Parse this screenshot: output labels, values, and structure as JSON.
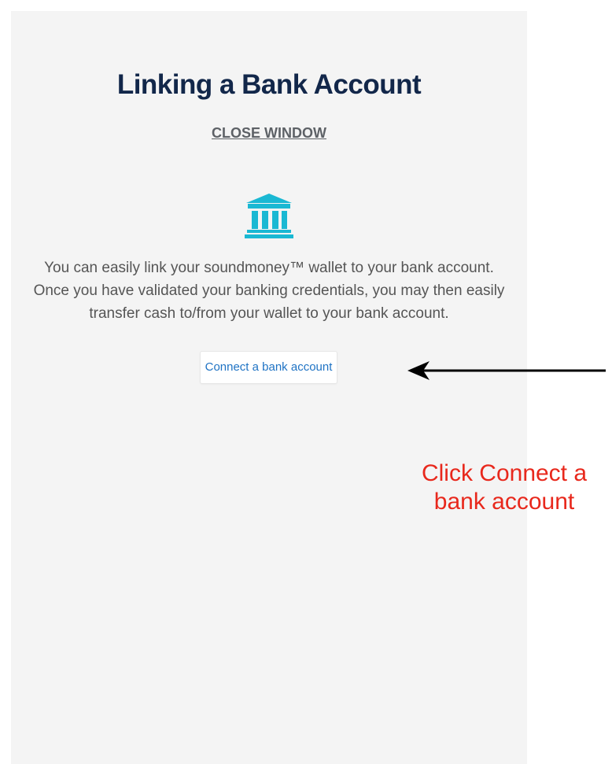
{
  "dialog": {
    "title": "Linking a Bank Account",
    "close_label": "CLOSE WINDOW",
    "icon": "bank-icon",
    "description_lines": [
      "You can easily link your soundmoney™ wallet to your bank account.",
      "Once you have validated your banking credentials, you may then easily",
      "transfer cash to/from your wallet to your bank account."
    ],
    "connect_label": "Connect a bank account"
  },
  "annotation": {
    "lines": [
      "Click Connect a",
      "bank account"
    ]
  },
  "colors": {
    "title": "#12274a",
    "icon": "#1ab8d3",
    "link": "#1f73c4",
    "annotation": "#e8281c",
    "panel": "#f4f4f4"
  }
}
